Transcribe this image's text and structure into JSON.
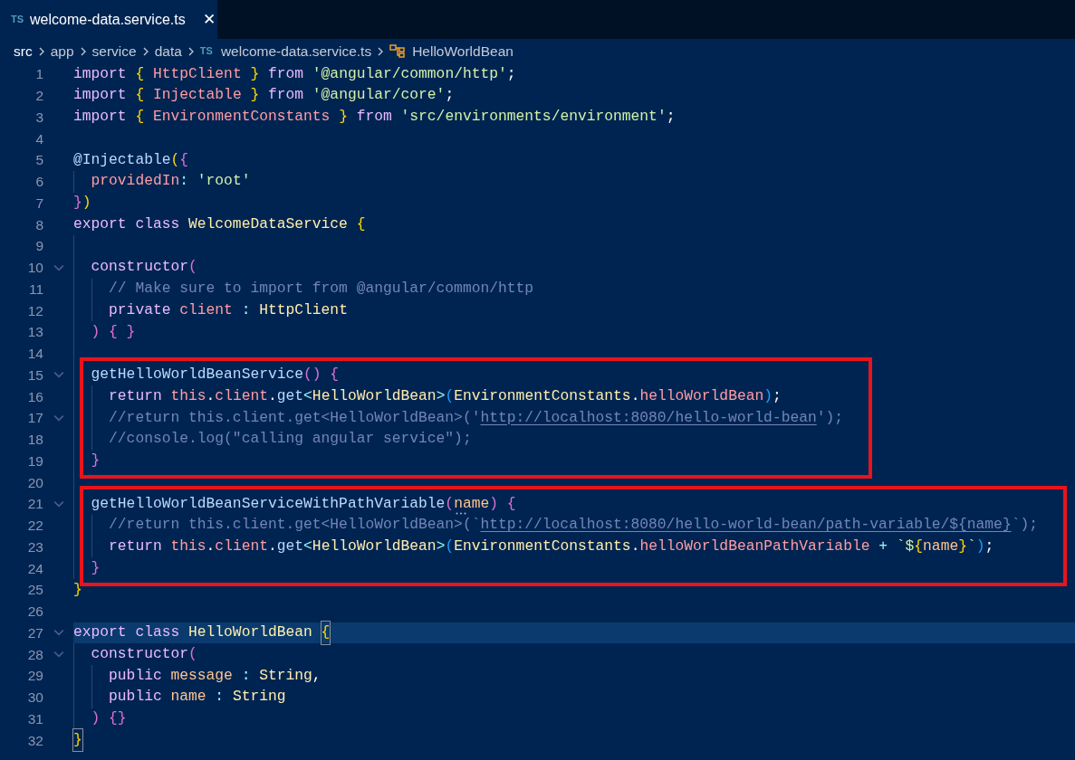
{
  "tab": {
    "icon_text": "TS",
    "title": "welcome-data.service.ts",
    "close": "✕",
    "selected": true
  },
  "breadcrumb": [
    {
      "kind": "folder",
      "label": "src"
    },
    {
      "kind": "folder",
      "label": "app"
    },
    {
      "kind": "folder",
      "label": "service"
    },
    {
      "kind": "folder",
      "label": "data"
    },
    {
      "kind": "file",
      "icon_text": "TS",
      "label": "welcome-data.service.ts"
    },
    {
      "kind": "class",
      "label": "HelloWorldBean"
    }
  ],
  "blocks": [
    {
      "boxed": false,
      "lines": [
        {
          "n": "1",
          "fold": false,
          "current": false,
          "tokens": [
            {
              "kind": "kw",
              "text": "import"
            },
            {
              "kind": "b1",
              "text": " {"
            },
            {
              "kind": "var",
              "text": " HttpClient"
            },
            {
              "kind": "b1",
              "text": " }"
            },
            {
              "kind": "kw",
              "text": " from"
            },
            {
              "kind": "str",
              "text": " '@angular/common/http'"
            },
            {
              "kind": "plain",
              "text": ";"
            }
          ]
        },
        {
          "n": "2",
          "fold": false,
          "current": false,
          "tokens": [
            {
              "kind": "kw",
              "text": "import"
            },
            {
              "kind": "b1",
              "text": " {"
            },
            {
              "kind": "var",
              "text": " Injectable"
            },
            {
              "kind": "b1",
              "text": " }"
            },
            {
              "kind": "kw",
              "text": " from"
            },
            {
              "kind": "str",
              "text": " '@angular/core'"
            },
            {
              "kind": "plain",
              "text": ";"
            }
          ]
        },
        {
          "n": "3",
          "fold": false,
          "current": false,
          "tokens": [
            {
              "kind": "kw",
              "text": "import"
            },
            {
              "kind": "b1",
              "text": " {"
            },
            {
              "kind": "var",
              "text": " EnvironmentConstants"
            },
            {
              "kind": "b1",
              "text": " }"
            },
            {
              "kind": "kw",
              "text": " from"
            },
            {
              "kind": "str",
              "text": " 'src/environments/environment'"
            },
            {
              "kind": "plain",
              "text": ";"
            }
          ]
        },
        {
          "n": "4",
          "fold": false,
          "current": false
        },
        {
          "n": "5",
          "fold": false,
          "current": false,
          "tokens": [
            {
              "kind": "fn",
              "text": "@Injectable"
            },
            {
              "kind": "b1",
              "text": "("
            },
            {
              "kind": "b2",
              "text": "{"
            }
          ]
        },
        {
          "n": "6",
          "fold": false,
          "current": false,
          "tokens": [
            {
              "kind": "var",
              "text": "  providedIn"
            },
            {
              "kind": "op",
              "text": ":"
            },
            {
              "kind": "str",
              "text": " 'root'"
            }
          ]
        },
        {
          "n": "7",
          "fold": false,
          "current": false,
          "tokens": [
            {
              "kind": "b2",
              "text": "}"
            },
            {
              "kind": "b1",
              "text": ")"
            }
          ]
        },
        {
          "n": "8",
          "fold": false,
          "current": false,
          "tokens": [
            {
              "kind": "kw",
              "text": "export class"
            },
            {
              "kind": "cls",
              "text": " WelcomeDataService"
            },
            {
              "kind": "b1",
              "text": " {"
            }
          ]
        },
        {
          "n": "9",
          "fold": false,
          "current": false
        },
        {
          "n": "10",
          "fold": true,
          "current": false,
          "tokens": [
            {
              "kind": "kw",
              "text": "  constructor"
            },
            {
              "kind": "b2",
              "text": "("
            }
          ]
        },
        {
          "n": "11",
          "fold": false,
          "current": false,
          "tokens": [
            {
              "kind": "cmt",
              "text": "    // Make sure to import from @angular/common/http"
            }
          ]
        },
        {
          "n": "12",
          "fold": false,
          "current": false,
          "tokens": [
            {
              "kind": "kw",
              "text": "    private"
            },
            {
              "kind": "var",
              "text": " client"
            },
            {
              "kind": "op",
              "text": " :"
            },
            {
              "kind": "cls",
              "text": " HttpClient"
            }
          ]
        },
        {
          "n": "13",
          "fold": false,
          "current": false,
          "tokens": [
            {
              "kind": "b2",
              "text": "  ) { }"
            }
          ]
        },
        {
          "n": "14",
          "fold": false,
          "current": false
        }
      ]
    },
    {
      "boxed": true,
      "lines": [
        {
          "n": "15",
          "fold": true,
          "current": false,
          "tokens": [
            {
              "kind": "fn",
              "text": "  getHelloWorldBeanService"
            },
            {
              "kind": "b2",
              "text": "() {"
            }
          ]
        },
        {
          "n": "16",
          "fold": false,
          "current": false,
          "tokens": [
            {
              "kind": "kw",
              "text": "    return"
            },
            {
              "kind": "var",
              "text": " this"
            },
            {
              "kind": "plain",
              "text": "."
            },
            {
              "kind": "var",
              "text": "client"
            },
            {
              "kind": "plain",
              "text": "."
            },
            {
              "kind": "fn",
              "text": "get"
            },
            {
              "kind": "op",
              "text": "<"
            },
            {
              "kind": "cls",
              "text": "HelloWorldBean"
            },
            {
              "kind": "op",
              "text": ">"
            },
            {
              "kind": "b3",
              "text": "("
            },
            {
              "kind": "cls",
              "text": "EnvironmentConstants"
            },
            {
              "kind": "plain",
              "text": "."
            },
            {
              "kind": "var",
              "text": "helloWorldBean"
            },
            {
              "kind": "b3",
              "text": ")"
            },
            {
              "kind": "plain",
              "text": ";"
            }
          ]
        },
        {
          "n": "17",
          "fold": true,
          "current": false,
          "tokens": [
            {
              "kind": "cmt",
              "text": "    //return this.client.get<HelloWorldBean>('"
            },
            {
              "kind": "link",
              "text": "http://localhost:8080/hello-world-bean"
            },
            {
              "kind": "cmt",
              "text": "');"
            }
          ]
        },
        {
          "n": "18",
          "fold": false,
          "current": false,
          "tokens": [
            {
              "kind": "cmt",
              "text": "    //console.log(\"calling angular service\");"
            }
          ]
        },
        {
          "n": "19",
          "fold": false,
          "current": false,
          "tokens": [
            {
              "kind": "b2",
              "text": "  }"
            }
          ]
        }
      ]
    },
    {
      "boxed": false,
      "lines": [
        {
          "n": "20",
          "fold": false,
          "current": false
        }
      ]
    },
    {
      "boxed": true,
      "lines": [
        {
          "n": "21",
          "fold": true,
          "current": false,
          "tokens": [
            {
              "kind": "fn",
              "text": "  getHelloWorldBeanServiceWithPathVariable"
            },
            {
              "kind": "b2",
              "text": "("
            },
            {
              "kind": "param_hint",
              "text": "name"
            },
            {
              "kind": "b2",
              "text": ") {"
            }
          ]
        },
        {
          "n": "22",
          "fold": false,
          "current": false,
          "tokens": [
            {
              "kind": "cmt",
              "text": "    //return this.client.get<HelloWorldBean>(`"
            },
            {
              "kind": "link",
              "text": "http://localhost:8080/hello-world-bean/path-variable/${name}"
            },
            {
              "kind": "cmt",
              "text": "`);"
            }
          ]
        },
        {
          "n": "23",
          "fold": false,
          "current": false,
          "tokens": [
            {
              "kind": "kw",
              "text": "    return"
            },
            {
              "kind": "var",
              "text": " this"
            },
            {
              "kind": "plain",
              "text": "."
            },
            {
              "kind": "var",
              "text": "client"
            },
            {
              "kind": "plain",
              "text": "."
            },
            {
              "kind": "fn",
              "text": "get"
            },
            {
              "kind": "op",
              "text": "<"
            },
            {
              "kind": "cls",
              "text": "HelloWorldBean"
            },
            {
              "kind": "op",
              "text": ">"
            },
            {
              "kind": "b3",
              "text": "("
            },
            {
              "kind": "cls",
              "text": "EnvironmentConstants"
            },
            {
              "kind": "plain",
              "text": "."
            },
            {
              "kind": "var",
              "text": "helloWorldBeanPathVariable"
            },
            {
              "kind": "op",
              "text": " +"
            },
            {
              "kind": "str",
              "text": " `$"
            },
            {
              "kind": "b1",
              "text": "{"
            },
            {
              "kind": "param",
              "text": "name"
            },
            {
              "kind": "b1",
              "text": "}"
            },
            {
              "kind": "str",
              "text": "`"
            },
            {
              "kind": "b3",
              "text": ")"
            },
            {
              "kind": "plain",
              "text": ";"
            }
          ]
        },
        {
          "n": "24",
          "fold": false,
          "current": false,
          "tokens": [
            {
              "kind": "b2",
              "text": "  }"
            }
          ]
        }
      ]
    },
    {
      "boxed": false,
      "lines": [
        {
          "n": "25",
          "fold": false,
          "current": false,
          "tokens": [
            {
              "kind": "b1",
              "text": "}"
            }
          ]
        },
        {
          "n": "26",
          "fold": false,
          "current": false
        },
        {
          "n": "27",
          "fold": true,
          "current": true,
          "tokens": [
            {
              "kind": "kw",
              "text": "export class"
            },
            {
              "kind": "cls",
              "text": " HelloWorldBean "
            },
            {
              "kind": "b1_match",
              "text": "{"
            }
          ]
        },
        {
          "n": "28",
          "fold": true,
          "current": false,
          "tokens": [
            {
              "kind": "kw",
              "text": "  constructor"
            },
            {
              "kind": "b2",
              "text": "("
            }
          ]
        },
        {
          "n": "29",
          "fold": false,
          "current": false,
          "tokens": [
            {
              "kind": "kw",
              "text": "    public"
            },
            {
              "kind": "param",
              "text": " message"
            },
            {
              "kind": "op",
              "text": " :"
            },
            {
              "kind": "cls",
              "text": " String"
            },
            {
              "kind": "plain",
              "text": ","
            }
          ]
        },
        {
          "n": "30",
          "fold": false,
          "current": false,
          "tokens": [
            {
              "kind": "kw",
              "text": "    public"
            },
            {
              "kind": "param",
              "text": " name"
            },
            {
              "kind": "op",
              "text": " :"
            },
            {
              "kind": "cls",
              "text": " String"
            }
          ]
        },
        {
          "n": "31",
          "fold": false,
          "current": false,
          "tokens": [
            {
              "kind": "b2",
              "text": "  ) {}"
            }
          ]
        },
        {
          "n": "32",
          "fold": false,
          "current": false,
          "tokens": [
            {
              "kind": "b1_match",
              "text": "}"
            }
          ]
        }
      ]
    }
  ]
}
